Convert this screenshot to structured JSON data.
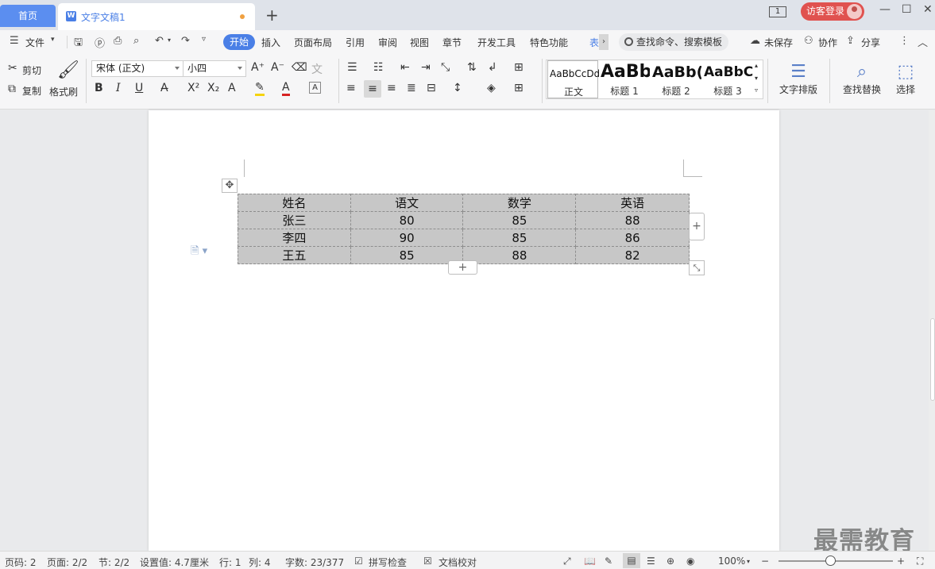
{
  "tabs": {
    "home": "首页",
    "document": "文字文稿1",
    "window_count": "1",
    "login": "访客登录"
  },
  "menu": {
    "file": "文件",
    "items": [
      "开始",
      "插入",
      "页面布局",
      "引用",
      "审阅",
      "视图",
      "章节",
      "开发工具",
      "特色功能",
      "表"
    ],
    "search_placeholder": "查找命令、搜索模板",
    "unsaved": "未保存",
    "collab": "协作",
    "share": "分享"
  },
  "ribbon": {
    "cut": "剪切",
    "copy": "复制",
    "format_painter": "格式刷",
    "font_name": "宋体 (正文)",
    "font_size": "小四",
    "styles": [
      {
        "sample": "AaBbCcDd",
        "name": "正文"
      },
      {
        "sample": "AaBb",
        "name": "标题 1"
      },
      {
        "sample": "AaBb(",
        "name": "标题 2"
      },
      {
        "sample": "AaBbC",
        "name": "标题 3"
      }
    ],
    "text_layout": "文字排版",
    "find_replace": "查找替换",
    "select": "选择"
  },
  "table": {
    "rows": [
      [
        "姓名",
        "语文",
        "数学",
        "英语"
      ],
      [
        "张三",
        "80",
        "85",
        "88"
      ],
      [
        "李四",
        "90",
        "85",
        "86"
      ],
      [
        "王五",
        "85",
        "88",
        "82"
      ]
    ]
  },
  "status": {
    "page_num": "页码: 2",
    "pages": "页面: 2/2",
    "section": "节: 2/2",
    "setting": "设置值: 4.7厘米",
    "row": "行: 1",
    "col": "列: 4",
    "words": "字数: 23/377",
    "spell": "拼写检查",
    "proof": "文档校对",
    "zoom": "100%",
    "zoom_level": 0.45
  },
  "watermark": "最需教育",
  "colors": {
    "accent": "#4a7fe6",
    "home_tab": "#5b8ef0",
    "login": "#e0524f",
    "table_fill": "#c7c7c7"
  }
}
